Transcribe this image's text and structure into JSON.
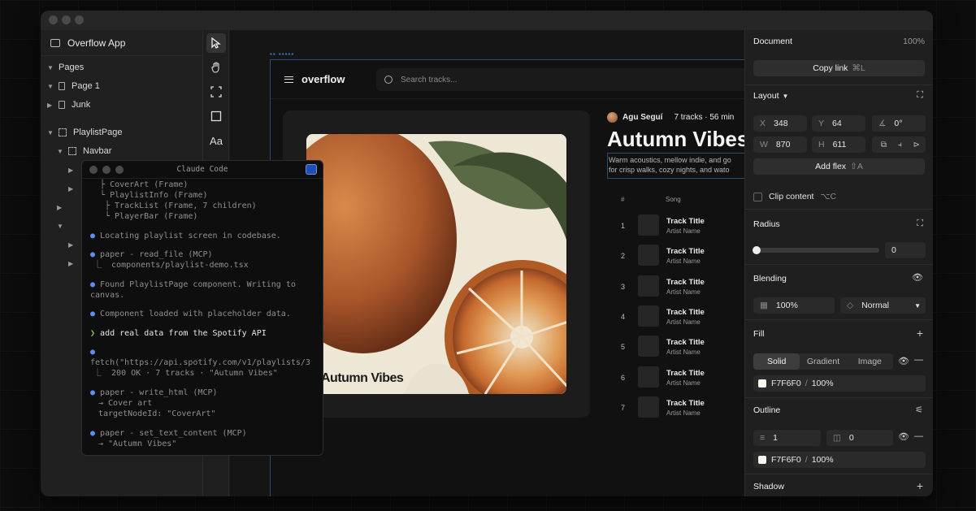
{
  "app": {
    "title": "Overflow App"
  },
  "layers": {
    "items": [
      {
        "label": "Pages"
      },
      {
        "label": "Page 1"
      },
      {
        "label": "Junk"
      },
      {
        "label": "PlaylistPage"
      },
      {
        "label": "Navbar"
      }
    ]
  },
  "tools": {
    "text_tool": "Aa"
  },
  "terminal": {
    "title": "Claude Code",
    "lines": [
      "  ├ CoverArt (Frame)",
      "  └ PlaylistInfo (Frame)",
      "├ TrackList (Frame, 7 children)",
      "└ PlayerBar (Frame)",
      "Locating playlist screen in codebase.",
      "paper - read_file (MCP)",
      "⎿  components/playlist-demo.tsx",
      "Found PlaylistPage component. Writing to",
      "canvas.",
      "Component loaded with placeholder data.",
      "add real data from the Spotify API",
      "fetch(\"https://api.spotify.com/v1/playlists/3",
      "⎿  200 OK · 7 tracks · \"Autumn Vibes\"",
      "paper - write_html (MCP)",
      "→ Cover art",
      "targetNodeId: \"CoverArt\"",
      "paper - set_text_content (MCP)",
      "→ \"Autumn Vibes\""
    ]
  },
  "canvas": {
    "brand": "overflow",
    "search_placeholder": "Search tracks...",
    "cover_title": "Autumn Vibes",
    "author": "Agu Seguí",
    "meta": "7 tracks · 56 min",
    "playlist_title": "Autumn Vibes",
    "description_1": "Warm acoustics, mellow indie, and go",
    "description_2": "for crisp walks, cozy nights, and wato",
    "col_num": "#",
    "col_song": "Song",
    "tracks": [
      {
        "num": "1",
        "title": "Track Title",
        "artist": "Artist Name"
      },
      {
        "num": "2",
        "title": "Track Title",
        "artist": "Artist Name"
      },
      {
        "num": "3",
        "title": "Track Title",
        "artist": "Artist Name"
      },
      {
        "num": "4",
        "title": "Track Title",
        "artist": "Artist Name"
      },
      {
        "num": "5",
        "title": "Track Title",
        "artist": "Artist Name"
      },
      {
        "num": "6",
        "title": "Track Title",
        "artist": "Artist Name"
      },
      {
        "num": "7",
        "title": "Track Title",
        "artist": "Artist Name"
      }
    ]
  },
  "inspector": {
    "document_label": "Document",
    "zoom": "100%",
    "copy_link": "Copy link",
    "copy_link_shortcut": "⌘L",
    "layout_label": "Layout",
    "x_label": "X",
    "x_value": "348",
    "y_label": "Y",
    "y_value": "64",
    "rotation": "0°",
    "w_label": "W",
    "w_value": "870",
    "h_label": "H",
    "h_value": "611",
    "add_flex": "Add flex",
    "add_flex_shortcut": "⇧A",
    "clip_content": "Clip content",
    "clip_shortcut": "⌥C",
    "radius_label": "Radius",
    "radius_value": "0",
    "blending_label": "Blending",
    "opacity": "100%",
    "blend_mode": "Normal",
    "fill_label": "Fill",
    "fill_tabs": [
      "Solid",
      "Gradient",
      "Image"
    ],
    "fill_color": "F7F6F0",
    "fill_opacity": "100%",
    "outline_label": "Outline",
    "outline_width": "1",
    "outline_radius": "0",
    "outline_color": "F7F6F0",
    "outline_opacity": "100%",
    "shadow_label": "Shadow"
  },
  "colors": {
    "accent": "#5b8ff0",
    "fill": "#F7F6F0",
    "selection": "#2e4a7a"
  }
}
